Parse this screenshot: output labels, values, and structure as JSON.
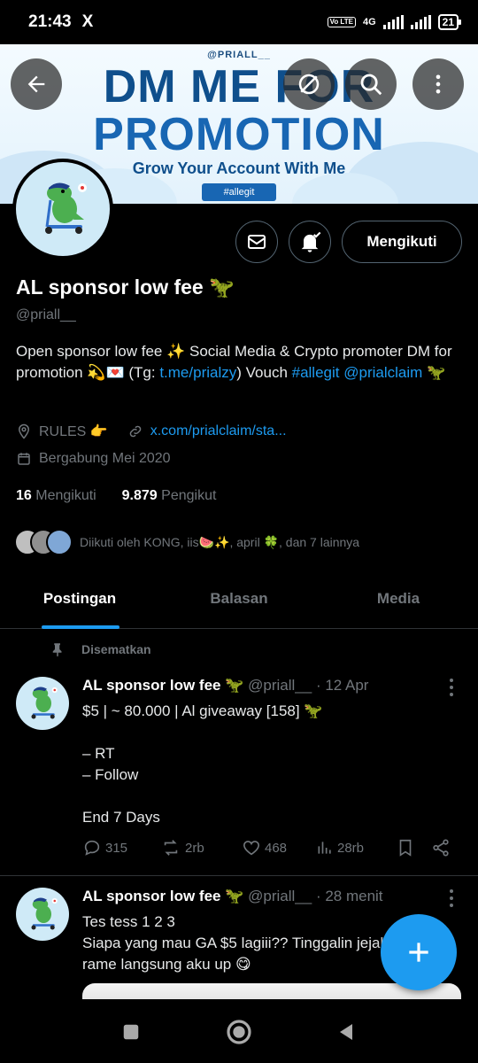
{
  "status_bar": {
    "time": "21:43",
    "app_icon": "X",
    "network": "4G",
    "volte": "Vo LTE",
    "battery": "21"
  },
  "banner": {
    "handle": "@PRIALL__",
    "line1": "DM ME FOR",
    "line2": "PROMOTION",
    "line3": "Grow Your Account With Me",
    "tag": "#allegit"
  },
  "header_buttons": [
    "back-icon",
    "hide-icon",
    "search-icon",
    "more-icon"
  ],
  "profile": {
    "name": "AL sponsor low fee 🦖",
    "handle": "@priall__",
    "bio_parts": {
      "p1": "Open sponsor low fee ✨ Social Media & Crypto promoter DM for promotion 💫💌  (Tg: ",
      "link1": "t.me/prialzy",
      "p2": ")  Vouch ",
      "tag1": "#allegit",
      "p3": " ",
      "mention1": "@prialclaim",
      "p4": " 🦖"
    },
    "rules": "RULES 👉",
    "website": "x.com/prialclaim/sta...",
    "joined": "Bergabung Mei 2020",
    "following_count": "16",
    "following_label": "Mengikuti",
    "followers_count": "9.879",
    "followers_label": "Pengikut",
    "followed_by": "Diikuti oleh KONG, iis🍉✨, april 🍀, dan 7 lainnya",
    "follow_button": "Mengikuti"
  },
  "tabs": [
    "Postingan",
    "Balasan",
    "Media"
  ],
  "pinned_label": "Disematkan",
  "posts": [
    {
      "name": "AL sponsor low fee 🦖",
      "handle": "@priall__",
      "time": "· 12 Apr",
      "text": "$5 | ~ 80.000 | Al giveaway [158] 🦖\n\n– RT\n– Follow\n\nEnd 7 Days",
      "replies": "315",
      "reposts": "2rb",
      "likes": "468",
      "views": "28rb"
    },
    {
      "name": "AL sponsor low fee 🦖",
      "handle": "@priall__",
      "time": "· 28 menit",
      "text": "Tes tess 1 2 3\nSiapa yang mau GA $5 lagiii?? Tinggalin jejak\nrame langsung aku up 😋"
    }
  ],
  "colors": {
    "accent": "#1d9bf0",
    "muted": "#71767b",
    "divider": "#2f3336",
    "banner_blue": "#0f4f8c"
  }
}
